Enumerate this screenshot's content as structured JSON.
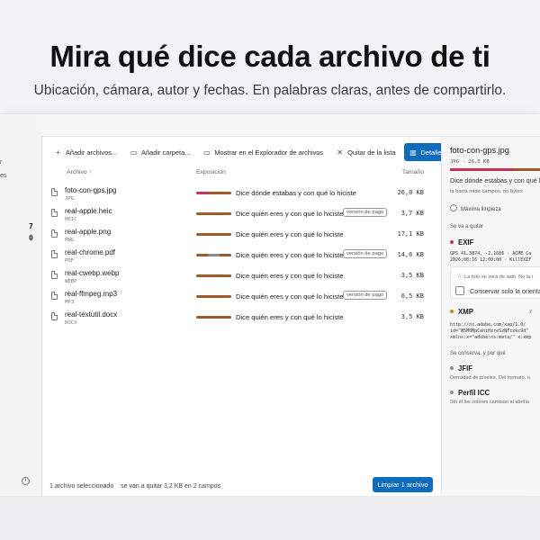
{
  "hero": {
    "title": "Mira qué dice cada archivo de ti",
    "subtitle": "Ubicación, cámara, autor y fechas. En palabras claras, antes de compartirlo."
  },
  "rail": {
    "text_1": "r",
    "text_2": "es",
    "num_1": "7",
    "num_2": "0",
    "info_icon": "info-icon"
  },
  "toolbar": {
    "add_files": "Añadir archivos...",
    "add_folder": "Añadir carpeta...",
    "show_explorer": "Mostrar en el Explorador de archivos",
    "remove": "Quitar de la lista",
    "details": "Detalles",
    "icons": {
      "add_files": "plus-icon",
      "add_folder": "folder-add-icon",
      "show_explorer": "folder-open-icon",
      "remove": "close-icon",
      "details": "details-pane-icon"
    }
  },
  "columns": {
    "file": "Archivo ↑",
    "exposure": "Exposición",
    "size": "Tamaño"
  },
  "files": [
    {
      "name": "foto-con-gps.jpg",
      "type": "JPG",
      "exposure": "Dice dónde estabas y con qué lo hiciste",
      "badge": "",
      "size": "26,0 KB",
      "bar": [
        "#c8305a",
        "#9d5a2b",
        "#9d5a2b"
      ]
    },
    {
      "name": "real-apple.heic",
      "type": "HEIC",
      "exposure": "Dice quién eres y con qué lo hiciste",
      "badge": "versión de pago",
      "size": "3,7 KB",
      "bar": [
        "#9d5a2b",
        "#9d5a2b",
        "#9d5a2b"
      ]
    },
    {
      "name": "real-apple.png",
      "type": "PNG",
      "exposure": "Dice quién eres y con qué lo hiciste",
      "badge": "",
      "size": "17,1 KB",
      "bar": [
        "#9d5a2b",
        "#9d5a2b",
        "#9d5a2b"
      ]
    },
    {
      "name": "real-chrome.pdf",
      "type": "PDF",
      "exposure": "Dice quién eres y con qué lo hiciste",
      "badge": "versión de pago",
      "size": "14,6 KB",
      "bar": [
        "#9d5a2b",
        "#8e8e93",
        "#9d5a2b"
      ]
    },
    {
      "name": "real-cwebp.webp",
      "type": "WEBP",
      "exposure": "Dice quién eres y con qué lo hiciste",
      "badge": "",
      "size": "3,5 KB",
      "bar": [
        "#9d5a2b",
        "#9d5a2b",
        "#9d5a2b"
      ]
    },
    {
      "name": "real-ffmpeg.mp3",
      "type": "MP3",
      "exposure": "Dice quién eres y con qué lo hiciste",
      "badge": "versión de pago",
      "size": "6,5 KB",
      "bar": [
        "#9d5a2b",
        "#9d5a2b",
        "#9d5a2b"
      ]
    },
    {
      "name": "real-textutil.docx",
      "type": "DOCX",
      "exposure": "Dice quién eres y con qué lo hiciste",
      "badge": "",
      "size": "3,5 KB",
      "bar": [
        "#9d5a2b",
        "#9d5a2b",
        "#9d5a2b"
      ]
    }
  ],
  "status": {
    "selected": "1 archivo seleccionado",
    "summary": "se van a quitar 3,2 KB en 2 campos",
    "clean_button": "Limpiar 1 archivo"
  },
  "detail": {
    "title": "foto-con-gps.jpg",
    "meta": "JPG · 26,0 KB",
    "description": "Dice dónde estabas y con qué lo",
    "note": "la barra mide campos, no bytes",
    "option": "Máxima limpieza",
    "remove_heading": "Se va a quitar",
    "exif_label": "EXIF",
    "exif_code": "GPS 41.3874, -2.1686 · ACME Ca",
    "exif_code2": "2026:08:16 12:00:00 · KillEXIF",
    "exif_warning": "La foto se verá de lado. No la r",
    "keep_orientation": "Conservar solo la orienta",
    "xmp_label": "XMP",
    "xmp_count": "2",
    "xmp_code1": "http://ns.adobe.com/xap/1.0/",
    "xmp_code2": "id=\"W5M0MpCehiHzreSzNTczkc9d\"",
    "xmp_code3": "xmlns:x=\"adobe:ns:meta/\" x:xmp",
    "keep_heading": "Se conserva, y por qué",
    "jfif_label": "JFIF",
    "jfif_desc": "Densidad de píxeles. Del formato, n",
    "icc_label": "Perfil ICC",
    "icc_desc": "Sin él los colores cambian al abrirla",
    "colors": {
      "exif": "#c8305a",
      "xmp": "#c98a1a",
      "kept": "#8e8e93"
    }
  },
  "colors": {
    "accent": "#0f6cbd",
    "danger": "#c8305a",
    "warn": "#9d5a2b"
  }
}
